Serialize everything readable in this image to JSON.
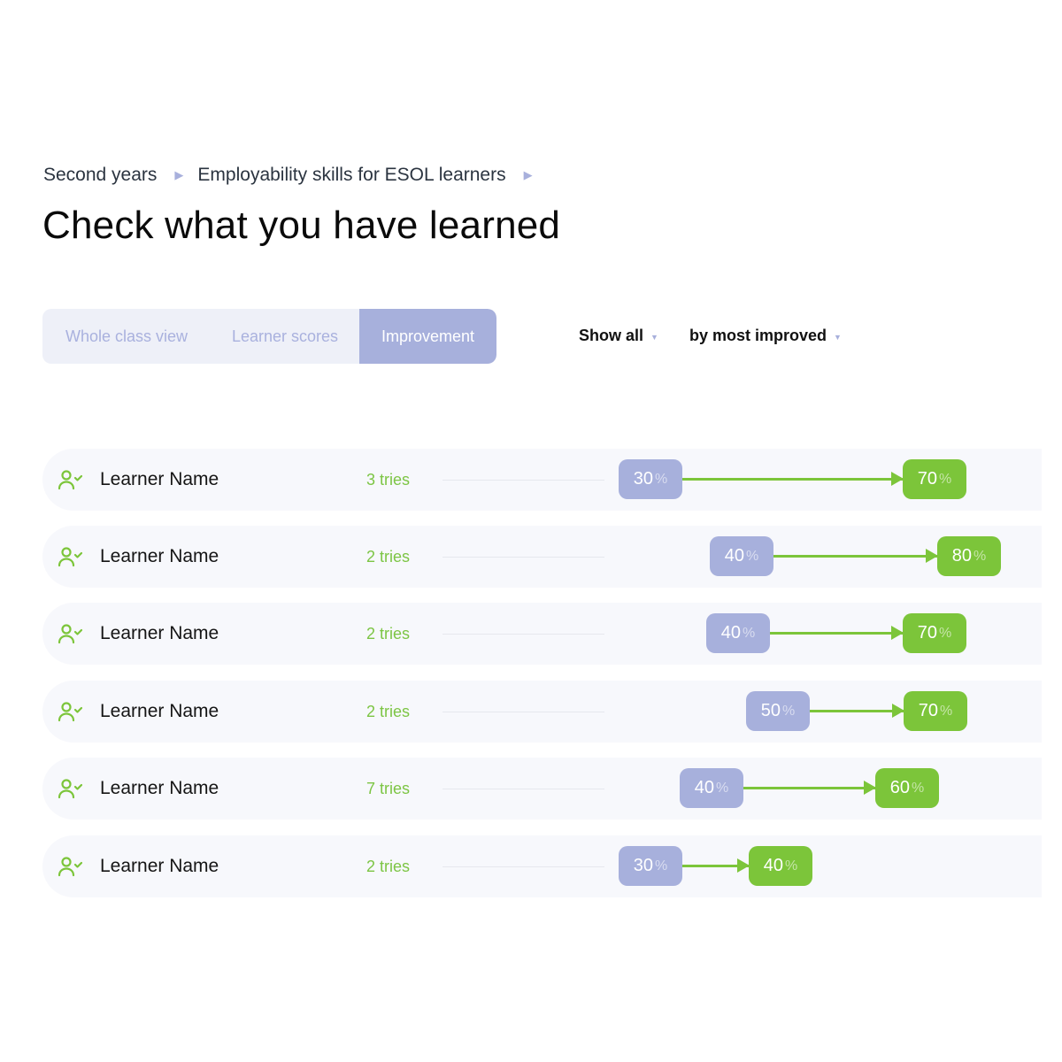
{
  "breadcrumb": [
    {
      "label": "Second years"
    },
    {
      "label": "Employability skills for ESOL learners"
    }
  ],
  "page_title": "Check what you have learned",
  "tabs": [
    {
      "label": "Whole class view",
      "active": false
    },
    {
      "label": "Learner scores",
      "active": false
    },
    {
      "label": "Improvement",
      "active": true
    }
  ],
  "filters": {
    "show": "Show all",
    "sort": "by most improved"
  },
  "percent_symbol": "%",
  "colors": {
    "start_score": "#a7b0dc",
    "end_score": "#7cc53a",
    "tries": "#7cc544",
    "learner_icon": "#7cc53a"
  },
  "learners": [
    {
      "name": "Learner Name",
      "tries": "3 tries",
      "start": "30",
      "end": "70"
    },
    {
      "name": "Learner Name",
      "tries": "2 tries",
      "start": "40",
      "end": "80"
    },
    {
      "name": "Learner Name",
      "tries": "2 tries",
      "start": "40",
      "end": "70"
    },
    {
      "name": "Learner Name",
      "tries": "2 tries",
      "start": "50",
      "end": "70"
    },
    {
      "name": "Learner Name",
      "tries": "7 tries",
      "start": "40",
      "end": "60"
    },
    {
      "name": "Learner Name",
      "tries": "2 tries",
      "start": "30",
      "end": "40"
    }
  ]
}
